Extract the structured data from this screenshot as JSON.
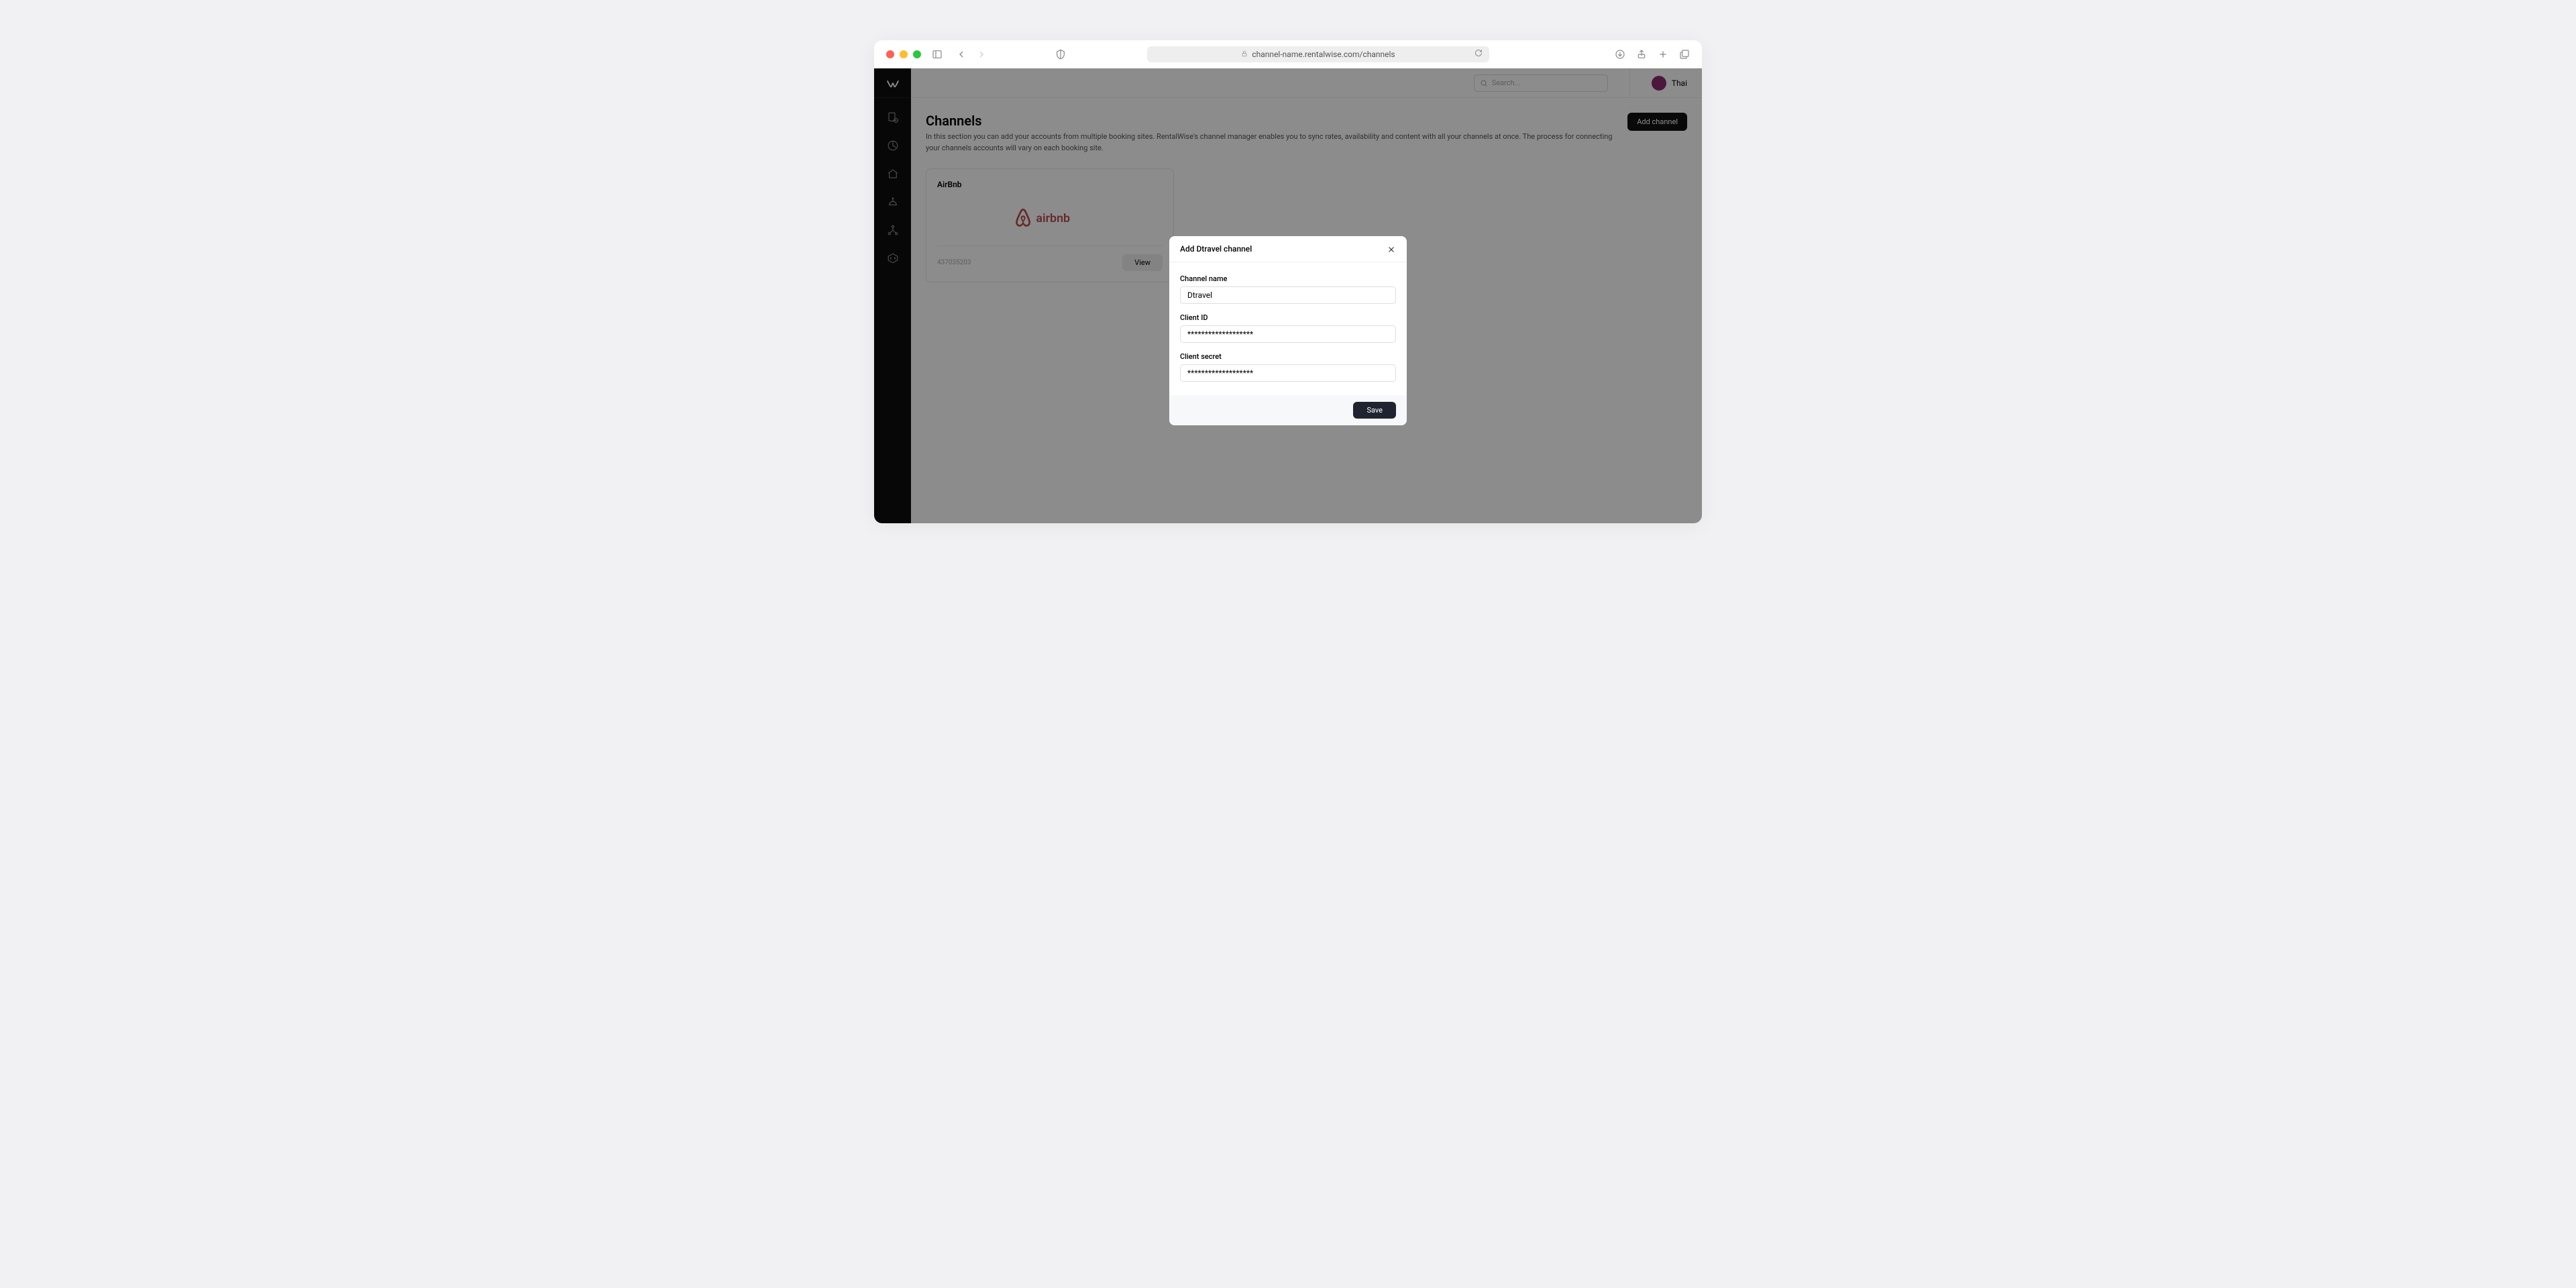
{
  "browser": {
    "url": "channel-name.rentalwise.com/channels"
  },
  "topbar": {
    "search_placeholder": "Search...",
    "user_name": "Thai"
  },
  "page": {
    "title": "Channels",
    "description": "In this section you can add your accounts from multiple booking sites. RentalWise's channel manager enables you to sync rates, availability and content with all your channels at once. The process for connecting your channels accounts will vary on each booking site.",
    "add_channel_label": "Add channel"
  },
  "card": {
    "title": "AirBnb",
    "logo_text": "airbnb",
    "id": "437035203",
    "view_label": "View"
  },
  "modal": {
    "title": "Add Dtravel channel",
    "channel_name_label": "Channel name",
    "channel_name_value": "Dtravel",
    "client_id_label": "Client ID",
    "client_id_value": "*******************",
    "client_secret_label": "Client secret",
    "client_secret_value": "*******************",
    "save_label": "Save"
  }
}
